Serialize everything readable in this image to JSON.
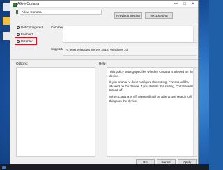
{
  "window": {
    "title": "Allow Cortana",
    "close_glyph": "✕",
    "minimize_glyph": "—",
    "maximize_glyph": "□"
  },
  "policy": {
    "name": "Allow Cortana"
  },
  "buttons": {
    "previous": "Previous Setting",
    "next": "Next Setting",
    "ok": "OK",
    "cancel": "Cancel",
    "apply": "Apply"
  },
  "options": [
    {
      "label": "Not Configured",
      "selected": false
    },
    {
      "label": "Enabled",
      "selected": false
    },
    {
      "label": "Disabled",
      "selected": true
    }
  ],
  "labels": {
    "comment": "Comment:",
    "supported_on": "Supported on:",
    "options": "Options:",
    "help": "Help:"
  },
  "supported_on_value": "At least Windows Server 2016, Windows 10",
  "help_paragraphs": [
    "This policy setting specifies whether Cortana is allowed on the device.",
    "If you enable or don't configure this setting, Cortana will be allowed on the device. If you disable this setting, Cortana will be turned off.",
    "When Cortana is off, users will still be able to use search to find things on the device."
  ],
  "colors": {
    "highlight": "#e01020",
    "desktop": "#2a6fc0"
  }
}
